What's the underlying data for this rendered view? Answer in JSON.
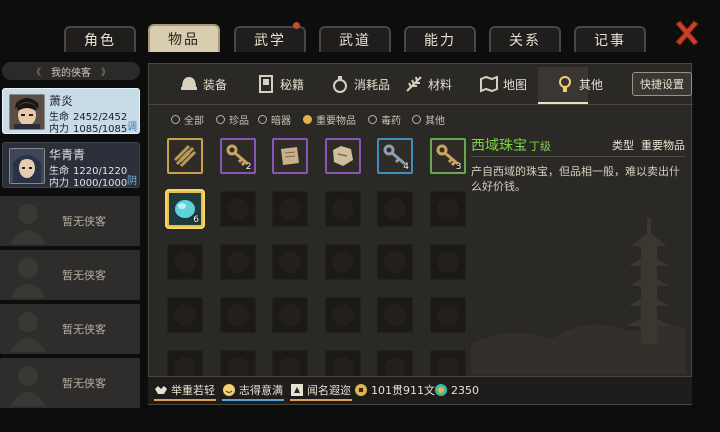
{
  "top_tabs": [
    {
      "label": "角色",
      "active": false,
      "badge": false
    },
    {
      "label": "物品",
      "active": true,
      "badge": false
    },
    {
      "label": "武学",
      "active": false,
      "badge": true
    },
    {
      "label": "武道",
      "active": false,
      "badge": false
    },
    {
      "label": "能力",
      "active": false,
      "badge": false
    },
    {
      "label": "关系",
      "active": false,
      "badge": false
    },
    {
      "label": "记事",
      "active": false,
      "badge": false
    }
  ],
  "party": {
    "header": "我的侠客",
    "heroes": [
      {
        "name": "萧炎",
        "hp_label": "生命",
        "hp": "2452/2452",
        "mp_label": "内力",
        "mp": "1085/1085",
        "tag": "调",
        "selected": true
      },
      {
        "name": "华青青",
        "hp_label": "生命",
        "hp": "1220/1220",
        "mp_label": "内力",
        "mp": "1000/1000",
        "tag": "阴",
        "selected": false
      }
    ],
    "empty_label": "暂无侠客",
    "empty_count": 4
  },
  "categories": [
    {
      "label": "装备",
      "icon": "helmet-icon"
    },
    {
      "label": "秘籍",
      "icon": "book-icon"
    },
    {
      "label": "消耗品",
      "icon": "potion-icon"
    },
    {
      "label": "材料",
      "icon": "herb-icon"
    },
    {
      "label": "地图",
      "icon": "map-icon"
    },
    {
      "label": "其他",
      "icon": "lamp-icon",
      "active": true
    }
  ],
  "quick_settings": "快捷设置",
  "filters": [
    {
      "label": "全部",
      "on": false
    },
    {
      "label": "珍品",
      "on": false
    },
    {
      "label": "暗器",
      "on": false
    },
    {
      "label": "重要物品",
      "on": true
    },
    {
      "label": "毒药",
      "on": false
    },
    {
      "label": "其他",
      "on": false
    }
  ],
  "items": [
    {
      "name": "scroll-bundle",
      "qty": "",
      "border": "#c6a24a",
      "color": "#b89a5a"
    },
    {
      "name": "key",
      "qty": "2",
      "border": "#8a55b8",
      "color": "#c9a45e"
    },
    {
      "name": "letter",
      "qty": "",
      "border": "#8a55b8",
      "color": "#c9b08a"
    },
    {
      "name": "map-scrap",
      "qty": "",
      "border": "#8a55b8",
      "color": "#cdbf9a"
    },
    {
      "name": "iron-key",
      "qty": "4",
      "border": "#3d8fbf",
      "color": "#8f9fb0"
    },
    {
      "name": "bronze-key",
      "qty": "3",
      "border": "#6aa84f",
      "color": "#c9a45e"
    },
    {
      "name": "jewel",
      "qty": "6",
      "border": "#e8c04a",
      "color": "#5fd2d8",
      "selected": true
    }
  ],
  "detail": {
    "name": "西域珠宝",
    "grade": "丁级",
    "type_label": "类型",
    "type_value": "重要物品",
    "description": "产自西域的珠宝，但品相一般，难以卖出什么好价钱。"
  },
  "status_bar": {
    "traits": [
      {
        "label": "举重若轻",
        "icon": "strength-icon",
        "bar": "#e0a34a"
      },
      {
        "label": "志得意满",
        "icon": "face-icon",
        "bar": "#4fa8d8"
      },
      {
        "label": "闻名遐迩",
        "icon": "fame-icon",
        "bar": "#e0a34a"
      }
    ],
    "money": "101贯911文",
    "gems": "2350"
  },
  "colors": {
    "accent_green": "#7fd14a",
    "gold": "#e0b548",
    "panel": "#2a2926"
  }
}
